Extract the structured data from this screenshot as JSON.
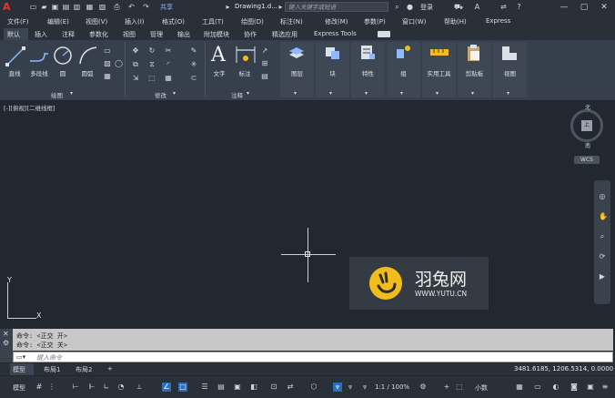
{
  "title_bar": {
    "app_logo": "A",
    "share_label": "共享",
    "document_title": "Drawing1.d...",
    "search_placeholder": "键入关键字或短语",
    "login_label": "登录"
  },
  "menu_items": [
    "文件(F)",
    "编辑(E)",
    "视图(V)",
    "插入(I)",
    "格式(O)",
    "工具(T)",
    "绘图(D)",
    "标注(N)",
    "修改(M)",
    "参数(P)",
    "窗口(W)",
    "帮助(H)",
    "Express"
  ],
  "ribbon_tabs": [
    "默认",
    "插入",
    "注释",
    "参数化",
    "视图",
    "管理",
    "输出",
    "附加模块",
    "协作",
    "精选应用",
    "Express Tools"
  ],
  "draw_panel": {
    "tools": [
      "直线",
      "多段线",
      "圆",
      "圆弧"
    ],
    "label": "绘图"
  },
  "modify_panel": {
    "label": "修改"
  },
  "annotation_panel": {
    "tools": [
      "文字",
      "标注"
    ],
    "label": "注释"
  },
  "big_tools": [
    "图层",
    "块",
    "特性",
    "组",
    "实用工具",
    "剪贴板",
    "视图"
  ],
  "viewport_label": "[-][俯视][二维线框]",
  "viewcube": {
    "face": "上",
    "north": "北",
    "south": "南",
    "wcs": "WCS"
  },
  "ucs": {
    "x": "X",
    "y": "Y"
  },
  "watermark": {
    "title": "羽兔网",
    "url": "WWW.YUTU.CN"
  },
  "command_history": [
    "命令: <正交 开>",
    "命令: <正交 关>"
  ],
  "command_placeholder": "键入命令",
  "layout_tabs": [
    "模型",
    "布局1",
    "布局2"
  ],
  "coordinates": "3481.6185, 1206.5314, 0.0000",
  "status": {
    "model": "模型",
    "scale": "1:1 / 100%",
    "units": "小数"
  }
}
